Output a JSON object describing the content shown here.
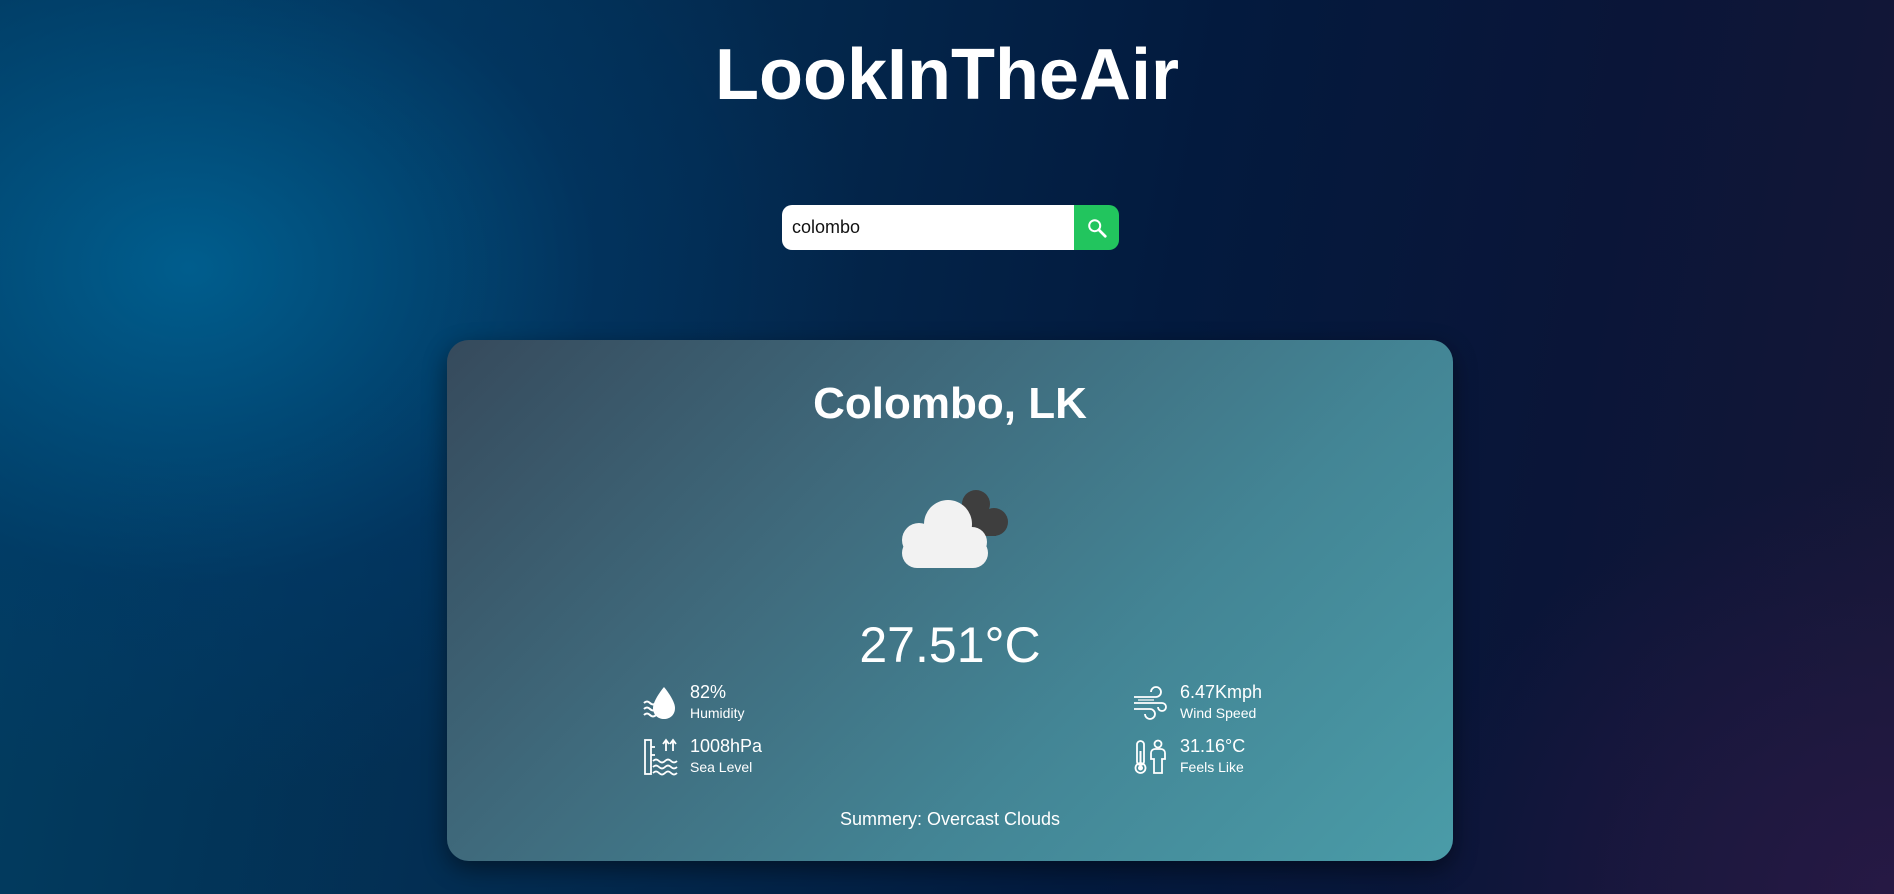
{
  "app": {
    "title": "LookInTheAir"
  },
  "search": {
    "value": "colombo",
    "button_icon": "search-icon"
  },
  "weather": {
    "city": "Colombo, LK",
    "icon": "overcast-clouds-icon",
    "temperature": "27.51°C",
    "stats": {
      "humidity": {
        "value": "82%",
        "label": "Humidity",
        "icon": "humidity-icon"
      },
      "sea_level": {
        "value": "1008hPa",
        "label": "Sea Level",
        "icon": "sea-level-icon"
      },
      "wind_speed": {
        "value": "6.47Kmph",
        "label": "Wind Speed",
        "icon": "wind-icon"
      },
      "feels_like": {
        "value": "31.16°C",
        "label": "Feels Like",
        "icon": "feels-like-icon"
      }
    },
    "summary": "Summery: Overcast Clouds"
  },
  "colors": {
    "search_button": "#22c55e",
    "card_start": "#364a5c",
    "card_end": "#4a9ca8"
  }
}
